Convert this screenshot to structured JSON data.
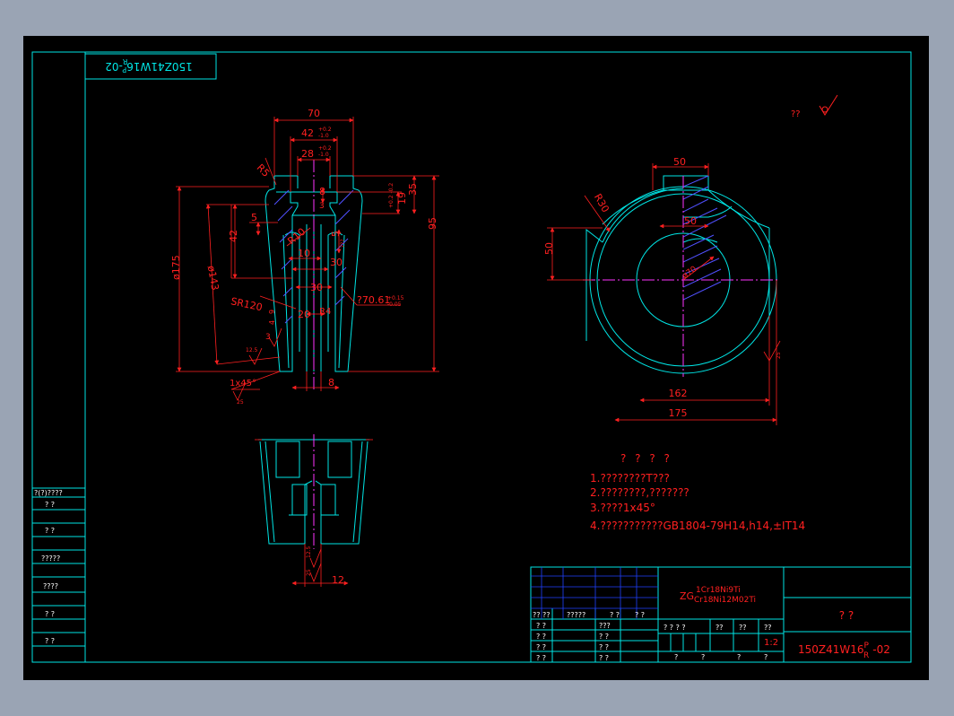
{
  "drawing": {
    "code_mirrored": "150Z41W16",
    "code_mirrored_sup": "P",
    "code_mirrored_sub": "R",
    "code_mirrored_suffix": "-02",
    "roughness_note": "??",
    "colors": {
      "frame": "#00e5e5",
      "dim": "#ff2020",
      "center": "#ff33ff",
      "bg": "#000000",
      "green": "#20c020",
      "blue": "#5050ff",
      "white": "#ffffff"
    }
  },
  "section_view": {
    "dims": {
      "d70": "70",
      "d42": "42",
      "d42_up": "+0.2",
      "d42_lo": "-1.0",
      "d28": "28",
      "d28_up": "+0.2",
      "d28_lo": "-1.0",
      "r5": "R5",
      "d8": "8",
      "d3": "3",
      "d19": "19",
      "d19_tol": "+0.2 -0.2",
      "d35": "35",
      "d95": "95",
      "d5a": "5",
      "d42v": "42",
      "dia175": "ø175",
      "dia143": "ø143",
      "r10": "R10",
      "d5b": "5",
      "d29": "???",
      "d10": "10",
      "d30a": "30",
      "d30b": "30",
      "sr120": "SR120",
      "dia70": "?70.61",
      "dia70_up": "+0.15",
      "dia70_lo": "-0.05",
      "r4": "R4",
      "d20": "20",
      "d9": "9",
      "d4": "4",
      "d3b": "3",
      "rough1": "12.5",
      "chamfer": "1x45°",
      "rough2": "25",
      "d8b": "8"
    }
  },
  "top_view": {
    "dims": {
      "d50a": "50",
      "r30": "R30",
      "d50b": "50",
      "d50v": "50",
      "dia70": "ø70",
      "d162": "162",
      "d175": "175",
      "rough": "25"
    }
  },
  "lower_view": {
    "dims": {
      "rough": "12.5",
      "rough2": "25",
      "d12": "12"
    }
  },
  "notes": {
    "title": "? ? ? ?",
    "lines": [
      "1.????????T???",
      "2.????????,???????",
      "3.????1x45°",
      "4.???????????GB1804-79H14,h14,±IT14"
    ]
  },
  "title_block": {
    "material_prefix": "ZG",
    "material_top": "1Cr18Ni9Ti",
    "material_bottom": "Cr18Ni12M02Ti",
    "name": "?  ?",
    "code": "150Z41W16",
    "code_sup": "P",
    "code_sub": "R",
    "code_suffix": "-02",
    "scale": "1:2",
    "header_row": [
      "?? ??",
      "?????",
      "? ?",
      "? ?"
    ],
    "left_rows": [
      [
        "? ?",
        "???"
      ],
      [
        "? ?",
        "? ?"
      ],
      [
        "? ?",
        "? ?"
      ],
      [
        "? ?",
        "? ?"
      ]
    ],
    "stage_header": [
      "? ? ? ?",
      "??",
      "??",
      "??"
    ],
    "bottom_row": [
      "?",
      "?",
      "?",
      "?"
    ]
  },
  "side_table": {
    "header": "?(?)????",
    "rows": [
      "?  ?",
      "?  ?",
      "?????",
      "????",
      "?  ?",
      "?  ?"
    ]
  }
}
